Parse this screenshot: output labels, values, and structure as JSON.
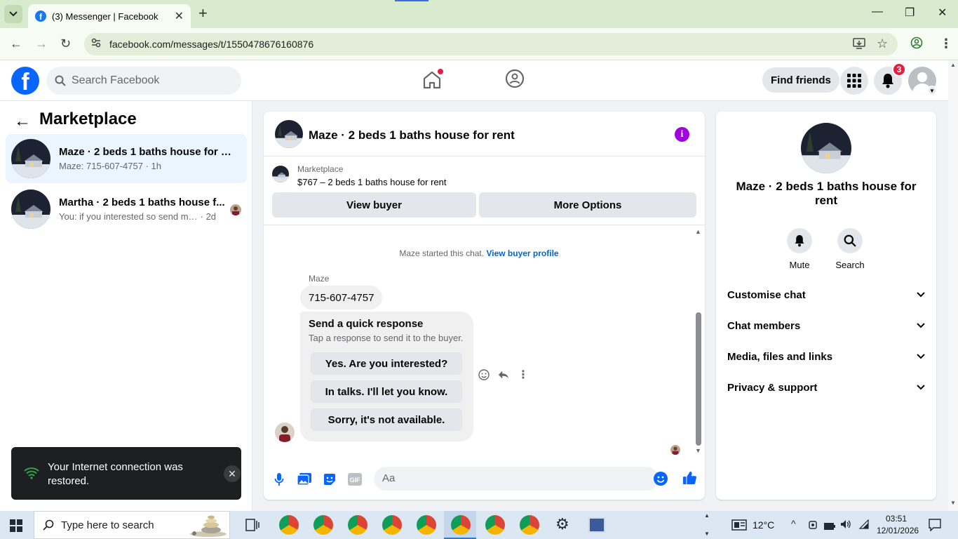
{
  "browser": {
    "tab_title": "(3) Messenger | Facebook",
    "url": "facebook.com/messages/t/1550478676160876"
  },
  "fb": {
    "search_placeholder": "Search Facebook",
    "find_friends": "Find friends",
    "notification_count": "3"
  },
  "left_panel": {
    "title": "Marketplace",
    "conversations": [
      {
        "name": "Maze · 2 beds 1 baths house for rent",
        "preview": "Maze: 715-607-4757",
        "time": "1h"
      },
      {
        "name": "Martha · 2 beds 1 baths house f...",
        "preview": "You: if you interested so send me n...",
        "time": "2d"
      }
    ]
  },
  "toast": {
    "message": "Your Internet connection was restored."
  },
  "chat": {
    "title": "Maze · 2 beds 1 baths house for rent",
    "marketplace_label": "Marketplace",
    "listing": "$767 – 2 beds 1 baths house for rent",
    "view_buyer": "View buyer",
    "more_options": "More Options",
    "started_text": "Maze started this chat.",
    "view_buyer_profile": "View buyer profile",
    "sender": "Maze",
    "phone_message": "715-607-4757",
    "quick_response_title": "Send a quick response",
    "quick_response_sub": "Tap a response to send it to the buyer.",
    "quick_responses": [
      "Yes. Are you interested?",
      "In talks. I'll let you know.",
      "Sorry, it's not available."
    ],
    "composer_placeholder": "Aa"
  },
  "info_panel": {
    "name": "Maze · 2 beds 1 baths house for rent",
    "mute": "Mute",
    "search": "Search",
    "sections": [
      "Customise chat",
      "Chat members",
      "Media, files and links",
      "Privacy & support"
    ]
  },
  "taskbar": {
    "search_placeholder": "Type here to search",
    "temperature": "12°C",
    "time": "03:51",
    "date": "12/01/2026"
  },
  "colors": {
    "fb_blue": "#0866ff",
    "messenger_purple": "#a100e0",
    "badge_red": "#e41e3f",
    "active_conversation": "#ebf5ff"
  }
}
